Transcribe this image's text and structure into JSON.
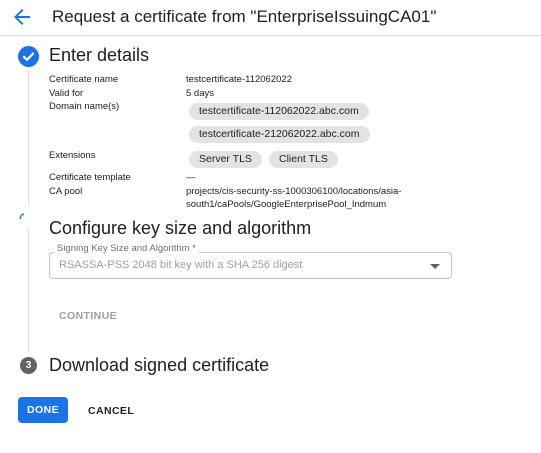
{
  "header": {
    "title": "Request a certificate from \"EnterpriseIssuingCA01\""
  },
  "steps": {
    "enter_details": {
      "title": "Enter details",
      "fields": {
        "certificate_name_label": "Certificate name",
        "certificate_name_value": "testcertificate-112062022",
        "valid_for_label": "Valid for",
        "valid_for_value": "5 days",
        "domain_names_label": "Domain name(s)",
        "domains": [
          "testcertificate-112062022.abc.com",
          "testcertificate-212062022.abc.com"
        ],
        "extensions_label": "Extensions",
        "extensions": [
          "Server TLS",
          "Client TLS"
        ],
        "certificate_template_label": "Certificate template",
        "certificate_template_value": "—",
        "ca_pool_label": "CA pool",
        "ca_pool_line1": "projects/cis-security-ss-1000306100/locations/asia-",
        "ca_pool_line2": "south1/caPools/GoogleEnterprisePool_Indmum"
      }
    },
    "configure_key": {
      "title": "Configure key size and algorithm",
      "select_label": "Signing Key Size and Algorithm *",
      "select_value": "RSASSA-PSS 2048 bit key with a SHA 256 digest",
      "continue_label": "CONTINUE"
    },
    "download": {
      "number": "3",
      "title": "Download signed certificate"
    }
  },
  "footer": {
    "done_label": "DONE",
    "cancel_label": "CANCEL"
  },
  "colors": {
    "accent": "#1a73e8",
    "chip_bg": "#e3e3e3",
    "muted": "#9aa0a6"
  }
}
